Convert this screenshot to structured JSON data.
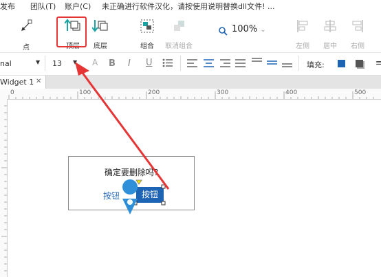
{
  "menu": {
    "items": [
      "发布",
      "团队(T)",
      "账户(C)"
    ],
    "notice": "未正确进行软件汉化，请按使用说明替换dll文件! ..."
  },
  "toolbar": {
    "point_label": "点",
    "bring_front_label": "顶层",
    "send_back_label": "底层",
    "group_label": "组合",
    "ungroup_label": "取消组合",
    "zoom_value": "100%",
    "align_left_label": "左侧",
    "align_center_label": "居中",
    "align_right_label": "右侧"
  },
  "format_bar": {
    "font_family_value": "nal",
    "font_size_value": "13",
    "fill_label": "填充:",
    "colors": {
      "fill": "#1e64b4",
      "shadow": "#555555"
    }
  },
  "tabs": [
    {
      "label": "Widget 1"
    }
  ],
  "ruler": {
    "marks": [
      "0",
      "100",
      "200",
      "300",
      "400",
      "500"
    ]
  },
  "dialog": {
    "message": "确定要删除吗?",
    "link_button_label": "按钮",
    "primary_button_label": "按钮"
  },
  "annotation": {
    "highlight_color": "#e53535"
  }
}
